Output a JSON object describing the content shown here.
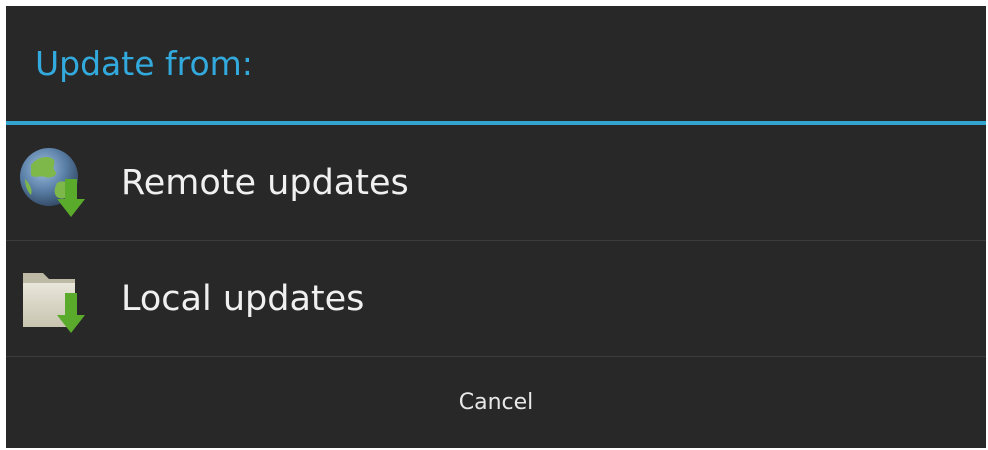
{
  "dialog": {
    "title": "Update from:",
    "accent_color": "#33aadd",
    "items": [
      {
        "label": "Remote updates",
        "icon": "globe-download-icon"
      },
      {
        "label": "Local updates",
        "icon": "folder-download-icon"
      }
    ],
    "cancel_label": "Cancel"
  }
}
